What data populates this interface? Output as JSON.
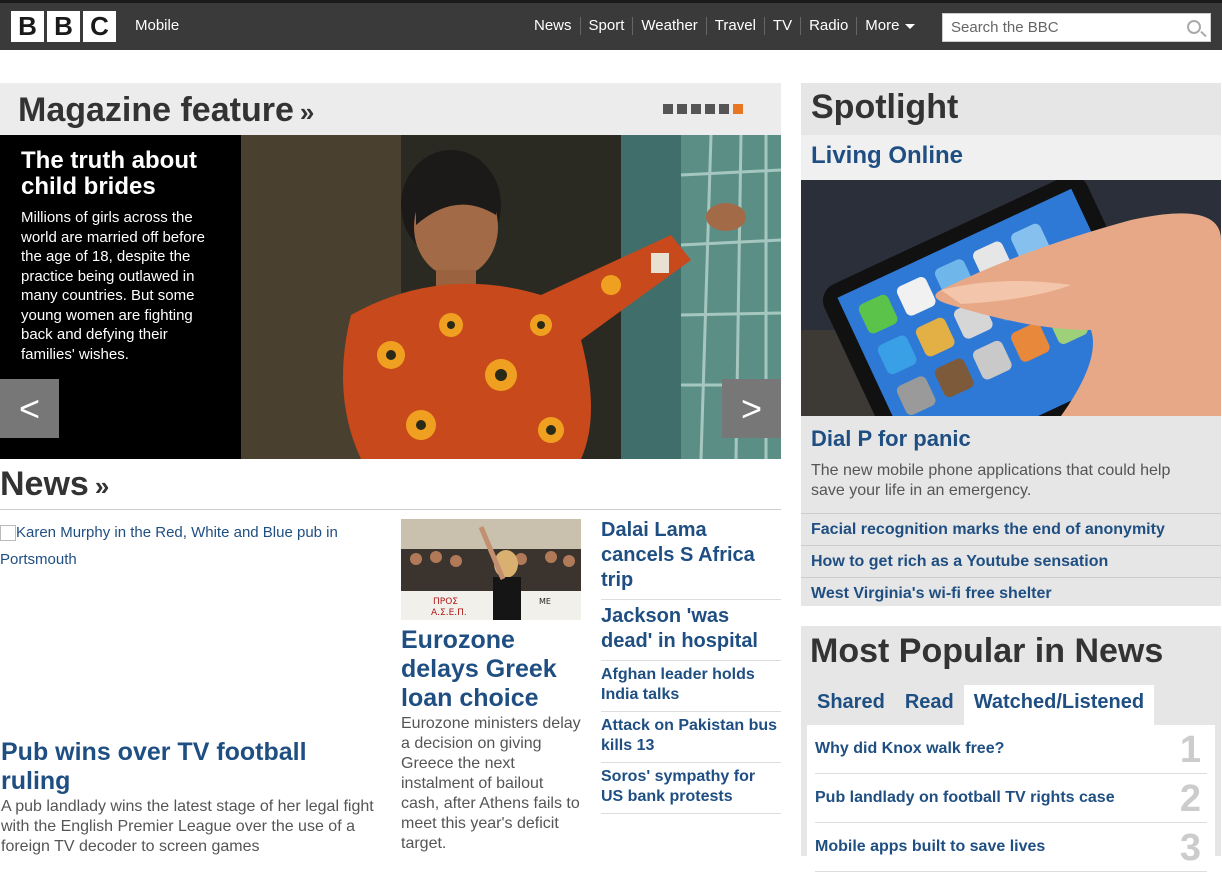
{
  "header": {
    "logo_letters": [
      "B",
      "B",
      "C"
    ],
    "site_label": "Mobile",
    "nav": [
      "News",
      "Sport",
      "Weather",
      "Travel",
      "TV",
      "Radio",
      "More"
    ],
    "search_placeholder": "Search the BBC"
  },
  "magazine": {
    "title": "Magazine feature",
    "chevron": "»",
    "active_dot": 5,
    "dot_count": 6,
    "headline": "The truth about child brides",
    "summary": "Millions of girls across the world are married off before the age of 18, despite the practice being outlawed in many countries. But some young women are fighting back and defying their families' wishes.",
    "prev_symbol": "<",
    "next_symbol": ">"
  },
  "news": {
    "title": "News",
    "chevron": "»",
    "lead": {
      "image_alt": "Karen Murphy in the Red, White and Blue pub in Portsmouth",
      "headline": "Pub wins over TV football ruling",
      "summary": "A pub landlady wins the latest stage of her legal fight with the English Premier League over the use of a foreign TV decoder to screen games"
    },
    "second": {
      "headline": "Eurozone delays Greek loan choice",
      "summary": "Eurozone ministers delay a decision on giving Greece the next instalment of bailout cash, after Athens fails to meet this year's deficit target."
    },
    "side_stories": [
      {
        "text": "Dalai Lama cancels S Africa trip",
        "size": "big"
      },
      {
        "text": "Jackson 'was dead' in hospital",
        "size": "big"
      },
      {
        "text": "Afghan leader holds India talks",
        "size": "small"
      },
      {
        "text": "Attack on Pakistan bus kills 13",
        "size": "small"
      },
      {
        "text": "Soros' sympathy for US bank protests",
        "size": "small"
      }
    ]
  },
  "spotlight": {
    "title": "Spotlight",
    "subtitle": "Living Online",
    "headline": "Dial P for panic",
    "summary": "The new mobile phone applications that could help save your life in an emergency.",
    "links": [
      "Facial recognition marks the end of anonymity",
      "How to get rich as a Youtube sensation",
      "West Virginia's wi-fi free shelter"
    ]
  },
  "popular": {
    "title": "Most Popular in News",
    "tabs": [
      "Shared",
      "Read",
      "Watched/Listened"
    ],
    "active_tab": 2,
    "items": [
      {
        "rank": "1",
        "text": "Why did Knox walk free?"
      },
      {
        "rank": "2",
        "text": "Pub landlady on football TV rights case"
      },
      {
        "rank": "3",
        "text": "Mobile apps built to save lives"
      }
    ]
  }
}
